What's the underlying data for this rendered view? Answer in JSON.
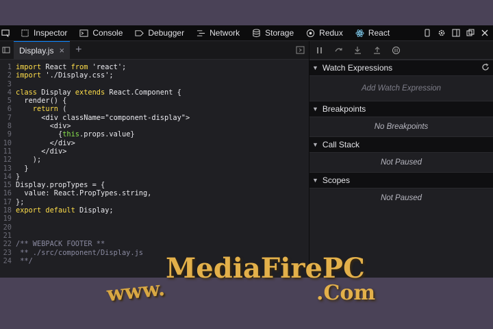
{
  "toolbar": {
    "tabs": [
      {
        "label": "Inspector",
        "icon": "inspector-icon"
      },
      {
        "label": "Console",
        "icon": "console-icon"
      },
      {
        "label": "Debugger",
        "icon": "debugger-icon"
      },
      {
        "label": "Network",
        "icon": "network-icon"
      },
      {
        "label": "Storage",
        "icon": "storage-icon"
      },
      {
        "label": "Redux",
        "icon": "redux-icon"
      },
      {
        "label": "React",
        "icon": "react-icon"
      }
    ]
  },
  "editor": {
    "file_tab": "Display.js",
    "close_glyph": "×",
    "add_glyph": "+",
    "lines": [
      {
        "n": "1",
        "parts": [
          [
            "kw",
            "import"
          ],
          [
            "plain",
            " React "
          ],
          [
            "kw",
            "from"
          ],
          [
            "str",
            " 'react';"
          ]
        ]
      },
      {
        "n": "2",
        "parts": [
          [
            "kw",
            "import"
          ],
          [
            "str",
            " './Display.css';"
          ]
        ]
      },
      {
        "n": "3",
        "parts": []
      },
      {
        "n": "4",
        "parts": [
          [
            "kw",
            "class"
          ],
          [
            "plain",
            " Display "
          ],
          [
            "kw",
            "extends"
          ],
          [
            "plain",
            " React.Component {"
          ]
        ]
      },
      {
        "n": "5",
        "parts": [
          [
            "plain",
            "  render() {"
          ]
        ]
      },
      {
        "n": "6",
        "parts": [
          [
            "kw",
            "    return"
          ],
          [
            "plain",
            " ("
          ]
        ]
      },
      {
        "n": "7",
        "parts": [
          [
            "plain",
            "      <div className="
          ],
          [
            "str",
            "\"component-display\""
          ],
          [
            "plain",
            ">"
          ]
        ]
      },
      {
        "n": "8",
        "parts": [
          [
            "plain",
            "        <div>"
          ]
        ]
      },
      {
        "n": "9",
        "parts": [
          [
            "plain",
            "          {"
          ],
          [
            "green",
            "this"
          ],
          [
            "plain",
            ".props.value}"
          ]
        ]
      },
      {
        "n": "10",
        "parts": [
          [
            "plain",
            "        </div>"
          ]
        ]
      },
      {
        "n": "11",
        "parts": [
          [
            "plain",
            "      </div>"
          ]
        ]
      },
      {
        "n": "12",
        "parts": [
          [
            "plain",
            "    );"
          ]
        ]
      },
      {
        "n": "13",
        "parts": [
          [
            "plain",
            "  }"
          ]
        ]
      },
      {
        "n": "14",
        "parts": [
          [
            "plain",
            "}"
          ]
        ]
      },
      {
        "n": "15",
        "parts": [
          [
            "plain",
            "Display.propTypes = {"
          ]
        ]
      },
      {
        "n": "16",
        "parts": [
          [
            "plain",
            "  value: React.PropTypes.string,"
          ]
        ]
      },
      {
        "n": "17",
        "parts": [
          [
            "plain",
            "};"
          ]
        ]
      },
      {
        "n": "18",
        "parts": [
          [
            "kw",
            "export"
          ],
          [
            "kw",
            " default"
          ],
          [
            "plain",
            " Display;"
          ]
        ]
      },
      {
        "n": "19",
        "parts": []
      },
      {
        "n": "20",
        "parts": []
      },
      {
        "n": "21",
        "parts": []
      },
      {
        "n": "22",
        "parts": [
          [
            "cmt",
            "/** WEBPACK FOOTER **"
          ]
        ]
      },
      {
        "n": "23",
        "parts": [
          [
            "cmt",
            " ** ./src/component/Display.js"
          ]
        ]
      },
      {
        "n": "24",
        "parts": [
          [
            "cmt",
            " **/"
          ]
        ]
      }
    ]
  },
  "debugger": {
    "sections": [
      {
        "title": "Watch Expressions",
        "body": "Add Watch Expression",
        "refresh": true
      },
      {
        "title": "Breakpoints",
        "body": "No Breakpoints"
      },
      {
        "title": "Call Stack",
        "body": "Not Paused"
      },
      {
        "title": "Scopes",
        "body": "Not Paused"
      }
    ]
  },
  "watermark": {
    "www": "www.",
    "brand": "MediaFirePC",
    "com": ".Com"
  }
}
